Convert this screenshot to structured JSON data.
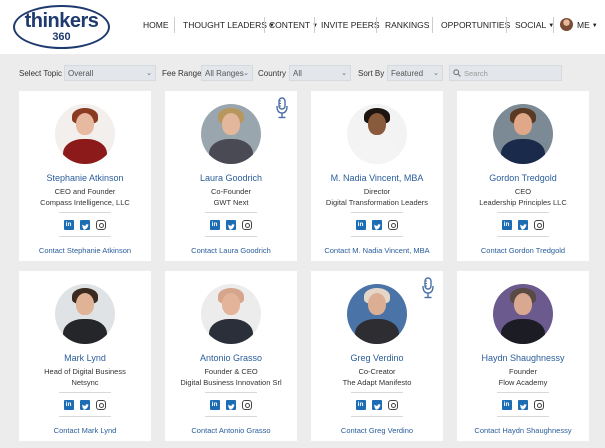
{
  "logo": {
    "word": "thinkers",
    "num": "360"
  },
  "nav": {
    "items": [
      {
        "label": "HOME",
        "caret": false
      },
      {
        "label": "THOUGHT LEADERS",
        "caret": true
      },
      {
        "label": "CONTENT",
        "caret": true
      },
      {
        "label": "INVITE PEERS",
        "caret": false
      },
      {
        "label": "RANKINGS",
        "caret": false
      },
      {
        "label": "OPPORTUNITIES",
        "caret": false
      },
      {
        "label": "SOCIAL",
        "caret": true
      },
      {
        "label": "ME",
        "caret": true
      }
    ]
  },
  "filters": {
    "topic_label": "Select Topic",
    "topic_value": "Overall",
    "fee_label": "Fee Range",
    "fee_value": "All Ranges",
    "country_label": "Country",
    "country_value": "All",
    "sort_label": "Sort By",
    "sort_value": "Featured",
    "search_placeholder": "Search"
  },
  "people": [
    {
      "name": "Stephanie Atkinson",
      "title": "CEO and Founder",
      "org": "Compass Intelligence, LLC",
      "contact": "Contact Stephanie Atkinson",
      "mic": false,
      "photo": {
        "bg": "#f2efed",
        "skin": "#e6b9a0",
        "hair": "#8a3b22",
        "body": "#8d1a1a"
      }
    },
    {
      "name": "Laura Goodrich",
      "title": "Co-Founder",
      "org": "GWT Next",
      "contact": "Contact Laura Goodrich",
      "mic": true,
      "photo": {
        "bg": "#9aa6ad",
        "skin": "#e2b79b",
        "hair": "#b8975e",
        "body": "#4a4a55"
      }
    },
    {
      "name": "M. Nadia Vincent, MBA",
      "title": "Director",
      "org": "Digital Transformation Leaders",
      "contact": "Contact M. Nadia Vincent, MBA",
      "mic": false,
      "photo": {
        "bg": "#f3f3f3",
        "skin": "#8a5a3c",
        "hair": "#1e1410",
        "body": "#f4f4f4"
      }
    },
    {
      "name": "Gordon Tredgold",
      "title": "CEO",
      "org": "Leadership Principles LLC",
      "contact": "Contact Gordon Tredgold",
      "mic": false,
      "photo": {
        "bg": "#7c8a95",
        "skin": "#e0a888",
        "hair": "#5a3a22",
        "body": "#1a2a4a"
      }
    },
    {
      "name": "Mark Lynd",
      "title": "Head of Digital Business",
      "org": "Netsync",
      "contact": "Contact Mark Lynd",
      "mic": false,
      "photo": {
        "bg": "#dfe3e6",
        "skin": "#e0b296",
        "hair": "#3a2a20",
        "body": "#25262a"
      }
    },
    {
      "name": "Antonio Grasso",
      "title": "Founder & CEO",
      "org": "Digital Business Innovation Srl",
      "contact": "Contact Antonio Grasso",
      "mic": false,
      "photo": {
        "bg": "#ececec",
        "skin": "#e4b49a",
        "hair": "#d6a68c",
        "body": "#2b2f3a"
      }
    },
    {
      "name": "Greg Verdino",
      "title": "Co-Creator",
      "org": "The Adapt Manifesto",
      "contact": "Contact Greg Verdino",
      "mic": true,
      "photo": {
        "bg": "#4a73a8",
        "skin": "#dcae94",
        "hair": "#e6d6c8",
        "body": "#2d2d32"
      }
    },
    {
      "name": "Haydn Shaughnessy",
      "title": "Founder",
      "org": "Flow Academy",
      "contact": "Contact Haydn Shaughnessy",
      "mic": false,
      "photo": {
        "bg": "#6a5a8e",
        "skin": "#d8a890",
        "hair": "#5a4a44",
        "body": "#1c1c24"
      }
    }
  ],
  "colors": {
    "brand": "#1f3a6e",
    "link": "#2a5d9a",
    "social": "#1c6db4"
  },
  "icons": {
    "mic": "microphone-icon",
    "search": "search-icon",
    "linkedin": "linkedin-icon",
    "twitter": "twitter-icon",
    "instagram": "instagram-icon"
  }
}
